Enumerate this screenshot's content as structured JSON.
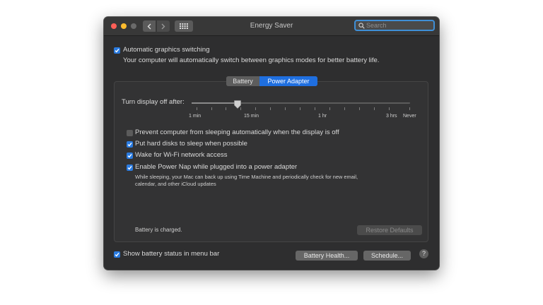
{
  "window": {
    "title": "Energy Saver",
    "search_placeholder": "Search"
  },
  "graphics": {
    "switching_label": "Automatic graphics switching",
    "switching_checked": true,
    "switching_description": "Your computer will automatically switch between graphics modes for better battery life."
  },
  "tabs": [
    {
      "label": "Battery",
      "selected": false
    },
    {
      "label": "Power Adapter",
      "selected": true
    }
  ],
  "display_slider": {
    "label": "Turn display off after:",
    "value": "10 min",
    "tick_labels": [
      "1 min",
      "15 min",
      "1 hr",
      "3 hrs",
      "Never"
    ]
  },
  "options": [
    {
      "label": "Prevent computer from sleeping automatically when the display is off",
      "checked": false
    },
    {
      "label": "Put hard disks to sleep when possible",
      "checked": true
    },
    {
      "label": "Wake for Wi-Fi network access",
      "checked": true
    },
    {
      "label": "Enable Power Nap while plugged into a power adapter",
      "checked": true
    }
  ],
  "power_nap_description_line1": "While sleeping, your Mac can back up using Time Machine and periodically check for new email,",
  "power_nap_description_line2": "calendar, and other iCloud updates",
  "battery_status_text": "Battery is charged.",
  "buttons": {
    "restore_defaults": "Restore Defaults",
    "battery_health": "Battery Health...",
    "schedule": "Schedule...",
    "help": "?"
  },
  "menu_bar_status": {
    "label": "Show battery status in menu bar",
    "checked": true
  },
  "colors": {
    "accent": "#2a7be0",
    "window_bg": "#2e2e2f",
    "close": "#ff5f57",
    "minimize": "#febc2e",
    "zoom_inactive": "#6a6a6a"
  },
  "icons": {
    "back": "chevron-left-icon",
    "forward": "chevron-right-icon",
    "show_all": "grid-icon",
    "search": "search-icon"
  }
}
